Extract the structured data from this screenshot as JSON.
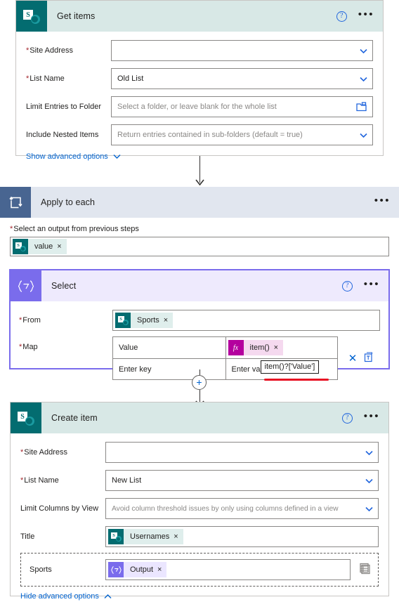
{
  "steps": [
    {
      "id": "get-items",
      "title": "Get items",
      "connector": "sharepoint",
      "help_label": "?",
      "more_label": "•••",
      "fields": [
        {
          "label": "Site Address",
          "required": true,
          "value": "",
          "placeholder": "",
          "control": "dropdown"
        },
        {
          "label": "List Name",
          "required": true,
          "value": "Old List",
          "placeholder": "",
          "control": "dropdown"
        },
        {
          "label": "Limit Entries to Folder",
          "required": false,
          "value": "",
          "placeholder": "Select a folder, or leave blank for the whole list",
          "control": "folder-picker"
        },
        {
          "label": "Include Nested Items",
          "required": false,
          "value": "",
          "placeholder": "Return entries contained in sub-folders (default = true)",
          "control": "dropdown"
        }
      ],
      "advanced_link": "Show advanced options"
    },
    {
      "id": "apply-to-each",
      "title": "Apply to each",
      "connector": "loop",
      "more_label": "•••",
      "output_label": "Select an output from previous steps",
      "output_required": true,
      "output_token": {
        "text": "value",
        "kind": "sharepoint",
        "remove": "×"
      }
    },
    {
      "id": "select",
      "title": "Select",
      "connector": "select",
      "help_label": "?",
      "more_label": "•••",
      "from_label": "From",
      "from_token": {
        "text": "Sports",
        "kind": "sharepoint",
        "remove": "×"
      },
      "map_label": "Map",
      "map_rows": [
        {
          "key": "Value",
          "key_placeholder": "",
          "value_token": {
            "text": "item()",
            "kind": "expression",
            "remove": "×"
          }
        },
        {
          "key": "",
          "key_placeholder": "Enter key",
          "value": "",
          "value_placeholder": "Enter value"
        }
      ],
      "delete_row_label": "✕",
      "tooltip": "item()?['Value']"
    },
    {
      "id": "create-item",
      "title": "Create item",
      "connector": "sharepoint",
      "help_label": "?",
      "more_label": "•••",
      "fields": [
        {
          "label": "Site Address",
          "required": true,
          "value": "",
          "placeholder": "",
          "control": "dropdown"
        },
        {
          "label": "List Name",
          "required": true,
          "value": "New List",
          "placeholder": "",
          "control": "dropdown"
        },
        {
          "label": "Limit Columns by View",
          "required": false,
          "value": "",
          "placeholder": "Avoid column threshold issues by only using columns defined in a view",
          "control": "dropdown"
        }
      ],
      "title_field": {
        "label": "Title",
        "token": {
          "text": "Usernames",
          "kind": "sharepoint",
          "remove": "×"
        }
      },
      "sports_field": {
        "label": "Sports",
        "token": {
          "text": "Output",
          "kind": "select",
          "remove": "×"
        }
      },
      "advanced_link": "Hide advanced options"
    }
  ],
  "connectors": {
    "add_step_label": "+"
  },
  "colors": {
    "sharepoint_teal": "#036c70",
    "sharepoint_header": "#d8e8e6",
    "loop_blue": "#486591",
    "loop_header": "#e1e6ef",
    "select_purple": "#7a6cec",
    "select_header": "#eeeafd",
    "link_blue": "#0264d0",
    "required_red": "#a4262c",
    "annotation_red": "#e81123",
    "expression_magenta": "#b4009e"
  }
}
